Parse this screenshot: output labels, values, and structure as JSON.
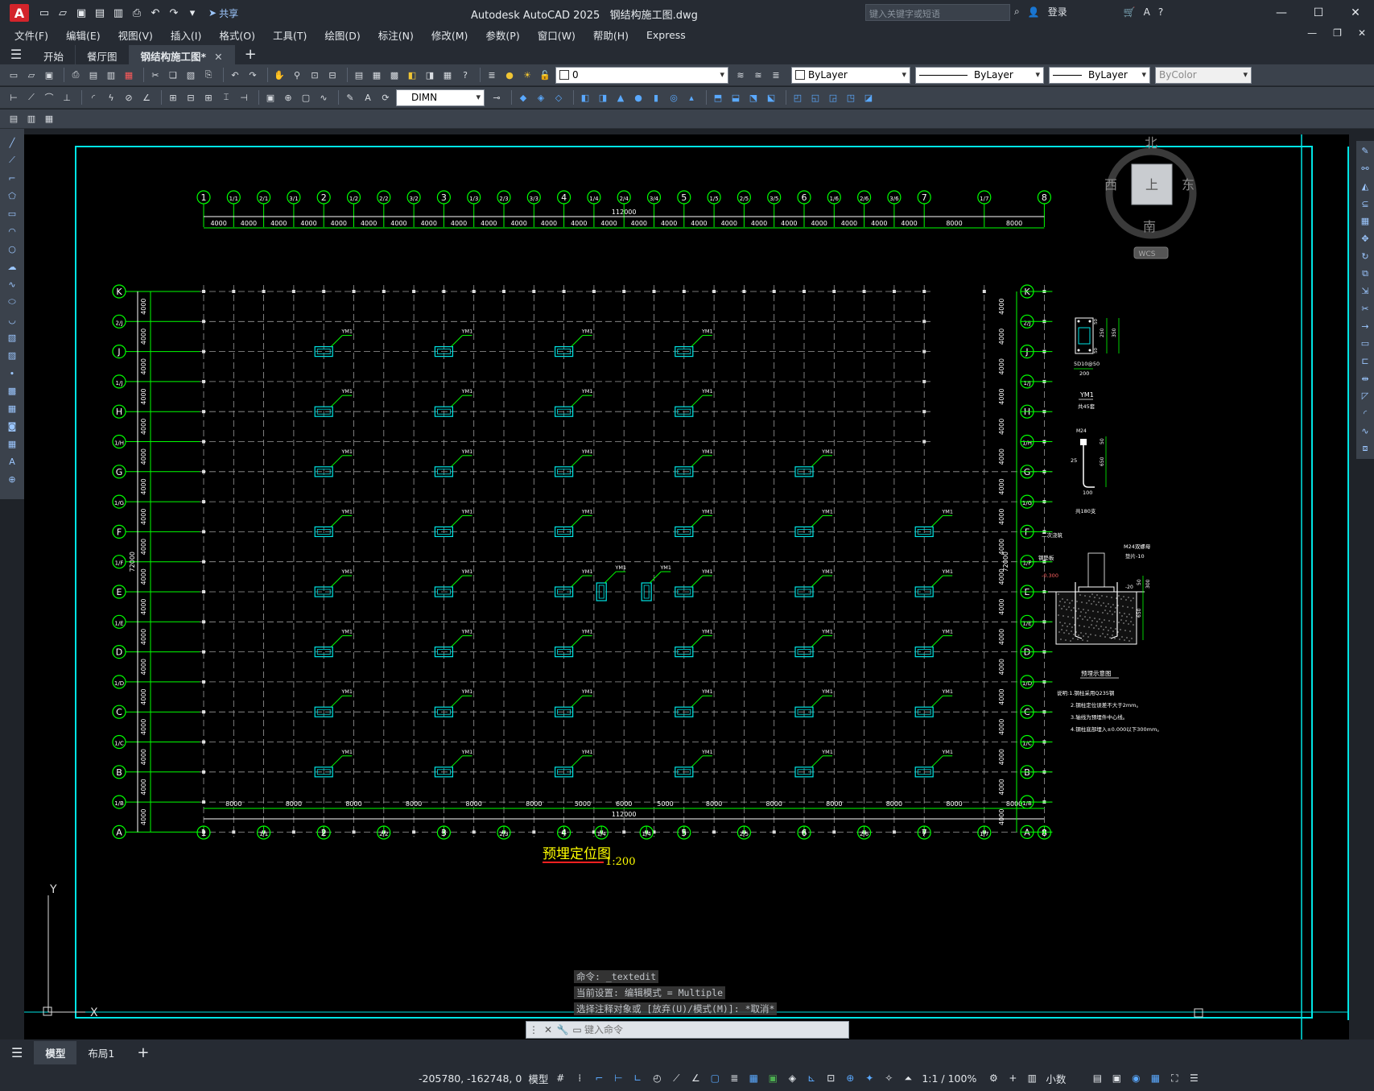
{
  "app": {
    "title": "Autodesk AutoCAD 2025",
    "filename": "钢结构施工图.dwg",
    "share": "共享",
    "search_placeholder": "键入关键字或短语",
    "login": "登录"
  },
  "menu": [
    "文件(F)",
    "编辑(E)",
    "视图(V)",
    "插入(I)",
    "格式(O)",
    "工具(T)",
    "绘图(D)",
    "标注(N)",
    "修改(M)",
    "参数(P)",
    "窗口(W)",
    "帮助(H)",
    "Express"
  ],
  "tabs": [
    {
      "label": "开始"
    },
    {
      "label": "餐厅图"
    },
    {
      "label": "钢结构施工图*"
    }
  ],
  "toolbar": {
    "layer": "0",
    "color": "ByLayer",
    "linetype": "ByLayer",
    "lineweight": "ByLayer",
    "plotstyle": "ByColor",
    "dimstyle": "DIMN"
  },
  "viewcube": {
    "north": "北",
    "south": "南",
    "east": "东",
    "west": "西",
    "top": "上",
    "wcs": "WCS"
  },
  "drawing": {
    "title": "预埋定位图",
    "scale": "1:200",
    "total_width_label": "112000",
    "total_height_label": "72000",
    "top_axes": [
      "1",
      "1/1",
      "2/1",
      "3/1",
      "2",
      "1/2",
      "2/2",
      "3/2",
      "3",
      "1/3",
      "2/3",
      "3/3",
      "4",
      "1/4",
      "2/4",
      "3/4",
      "5",
      "1/5",
      "2/5",
      "3/5",
      "6",
      "1/6",
      "2/6",
      "3/6",
      "7",
      "1/7",
      "8"
    ],
    "top_dims": [
      "4000",
      "4000",
      "4000",
      "4000",
      "4000",
      "4000",
      "4000",
      "4000",
      "4000",
      "4000",
      "4000",
      "4000",
      "4000",
      "4000",
      "4000",
      "4000",
      "4000",
      "4000",
      "4000",
      "4000",
      "4000",
      "4000",
      "4000",
      "4000",
      "8000",
      "8000"
    ],
    "bottom_axes": [
      "1",
      "1/1",
      "2",
      "2/2",
      "3",
      "2/3",
      "4",
      "1/4",
      "1/4",
      "5",
      "2/5",
      "6",
      "2/6",
      "7",
      "1/7",
      "8"
    ],
    "bottom_dims": [
      "8000",
      "8000",
      "8000",
      "8000",
      "8000",
      "8000",
      "5000",
      "6000",
      "5000",
      "8000",
      "8000",
      "8000",
      "8000",
      "8000",
      "8000"
    ],
    "rows": [
      "K",
      "2/J",
      "J",
      "1/J",
      "H",
      "1/H",
      "G",
      "1/G",
      "F",
      "1/F",
      "E",
      "1/E",
      "D",
      "1/D",
      "C",
      "1/C",
      "B",
      "1/B",
      "A"
    ],
    "row_dim": "4000",
    "embed_label": "YM1",
    "detail1": {
      "dim1": "250",
      "dim2": "350",
      "dim3": "50",
      "anchor": "5D10@50",
      "width": "200",
      "label": "YM1",
      "sub": "共45套"
    },
    "detail2": {
      "tag": "M24",
      "d1": "50",
      "d2": "650",
      "d3": "25",
      "d4": "100",
      "sub": "共180支"
    },
    "detail3": {
      "l1": "二次浇筑",
      "l2": "钢垫板",
      "l3": "M24双螺母",
      "l4": "垫片-10",
      "elev": "-0.300",
      "e2": "-20",
      "d1": "50",
      "d2": "300",
      "d3": "650",
      "title": "预埋示意图"
    },
    "notes": [
      "说明:1.钢柱采用Q235钢",
      "2.钢柱定位误差不大于2mm。",
      "3.轴线为预埋件中心线。",
      "4.钢柱底部埋入±0.000以下300mm。"
    ]
  },
  "command": {
    "history": [
      "命令: _textedit",
      "当前设置: 编辑模式 = Multiple",
      "选择注释对象或 [放弃(U)/模式(M)]: *取消*"
    ],
    "placeholder": "键入命令"
  },
  "layout_tabs": [
    "模型",
    "布局1"
  ],
  "status": {
    "coords": "-205780, -162748, 0",
    "model": "模型",
    "scale": "1:1 / 100%",
    "units": "小数"
  },
  "colors": {
    "accent": "#2d89ef",
    "grid_green": "#00ff00",
    "frame_cyan": "#00e5e5"
  }
}
